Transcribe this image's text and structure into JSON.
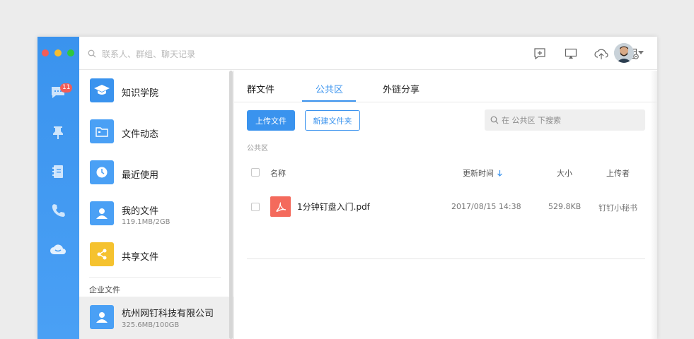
{
  "nav": {
    "badge_count": "11",
    "items": [
      {
        "icon": "chat-icon"
      },
      {
        "icon": "pin-icon"
      },
      {
        "icon": "contacts-icon"
      },
      {
        "icon": "phone-icon"
      },
      {
        "icon": "cloud-drive-icon"
      }
    ]
  },
  "topbar": {
    "search_placeholder": "联系人、群组、聊天记录",
    "icons": [
      "new-message-icon",
      "screen-share-icon",
      "cloud-upload-icon",
      "calendar-settings-icon"
    ]
  },
  "sidebar": {
    "items": [
      {
        "label": "知识学院",
        "color": "#3a93ee"
      },
      {
        "label": "文件动态",
        "color": "#4aa0f5"
      },
      {
        "label": "最近使用",
        "color": "#4aa0f5"
      },
      {
        "label": "我的文件",
        "sub": "119.1MB/2GB",
        "color": "#4aa0f5"
      },
      {
        "label": "共享文件",
        "color": "#f5c22f"
      }
    ],
    "section_title": "企业文件",
    "company": {
      "label": "杭州网钉科技有限公司",
      "sub": "325.6MB/100GB"
    }
  },
  "main": {
    "tabs": [
      {
        "label": "群文件"
      },
      {
        "label": "公共区"
      },
      {
        "label": "外链分享"
      }
    ],
    "upload_button": "上传文件",
    "new_folder_button": "新建文件夹",
    "search_placeholder": "在 公共区 下搜索",
    "breadcrumb": "公共区",
    "columns": {
      "name": "名称",
      "updated": "更新时间",
      "size": "大小",
      "uploader": "上传者"
    },
    "files": [
      {
        "name": "1分钟钉盘入门.pdf",
        "updated": "2017/08/15 14:38",
        "size": "529.8KB",
        "uploader": "钉钉小秘书"
      }
    ]
  },
  "colors": {
    "accent": "#3a93ee",
    "badge": "#f25c57",
    "pdf": "#f46a5c"
  }
}
